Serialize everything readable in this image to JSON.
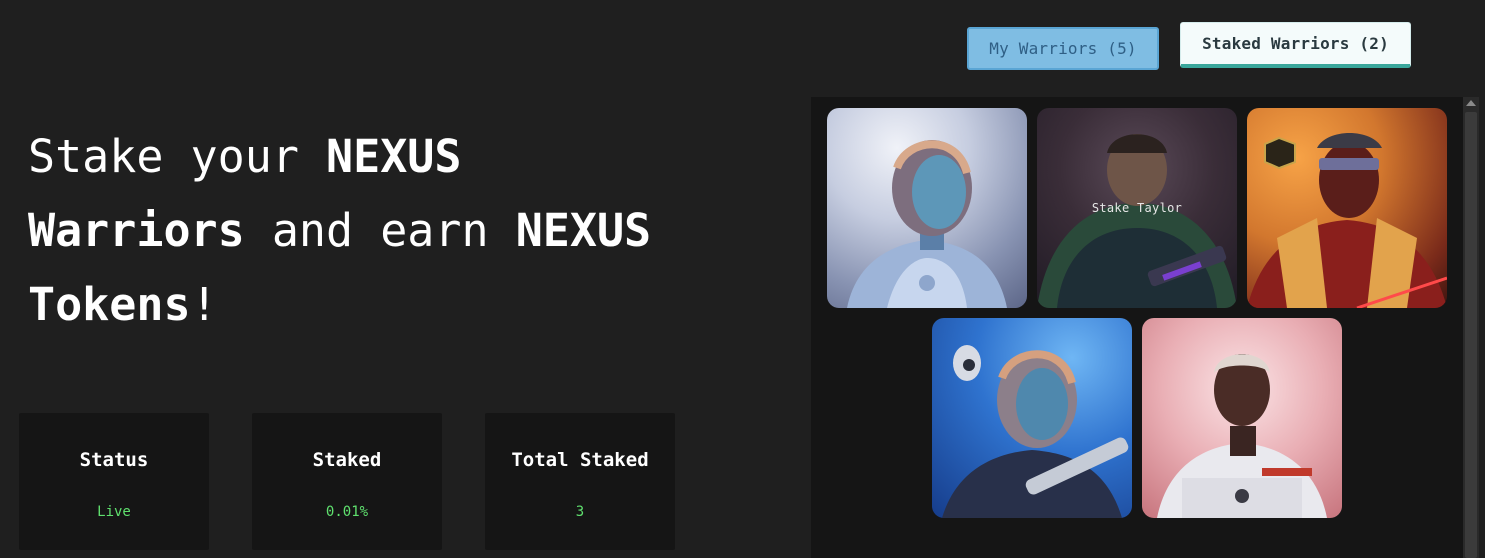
{
  "tabs": {
    "my_warriors": "My Warriors (5)",
    "staked_warriors": "Staked Warriors (2)"
  },
  "headline": {
    "part1": "Stake your ",
    "nexus1": "NEXUS",
    "warriors": "Warriors",
    "part2": " and earn ",
    "nexus2": "NEXUS",
    "tokens": "Tokens",
    "excl": "!"
  },
  "stats": [
    {
      "label": "Status",
      "value": "Live"
    },
    {
      "label": "Staked",
      "value": "0.01%"
    },
    {
      "label": "Total Staked",
      "value": "3"
    }
  ],
  "gallery": {
    "hover_label": "Stake Taylor",
    "cards": [
      {
        "icon": "warrior-helmet-blue"
      },
      {
        "icon": "warrior-hooded"
      },
      {
        "icon": "warrior-armored-red"
      },
      {
        "icon": "warrior-helmet-gun"
      },
      {
        "icon": "warrior-white-suit"
      }
    ]
  },
  "colors": {
    "background": "#1f1f1f",
    "card_bg": "#151515",
    "accent_green": "#5fe06e",
    "tab_blue": "#7fbde3",
    "tab_teal_border": "#3aa79c"
  }
}
